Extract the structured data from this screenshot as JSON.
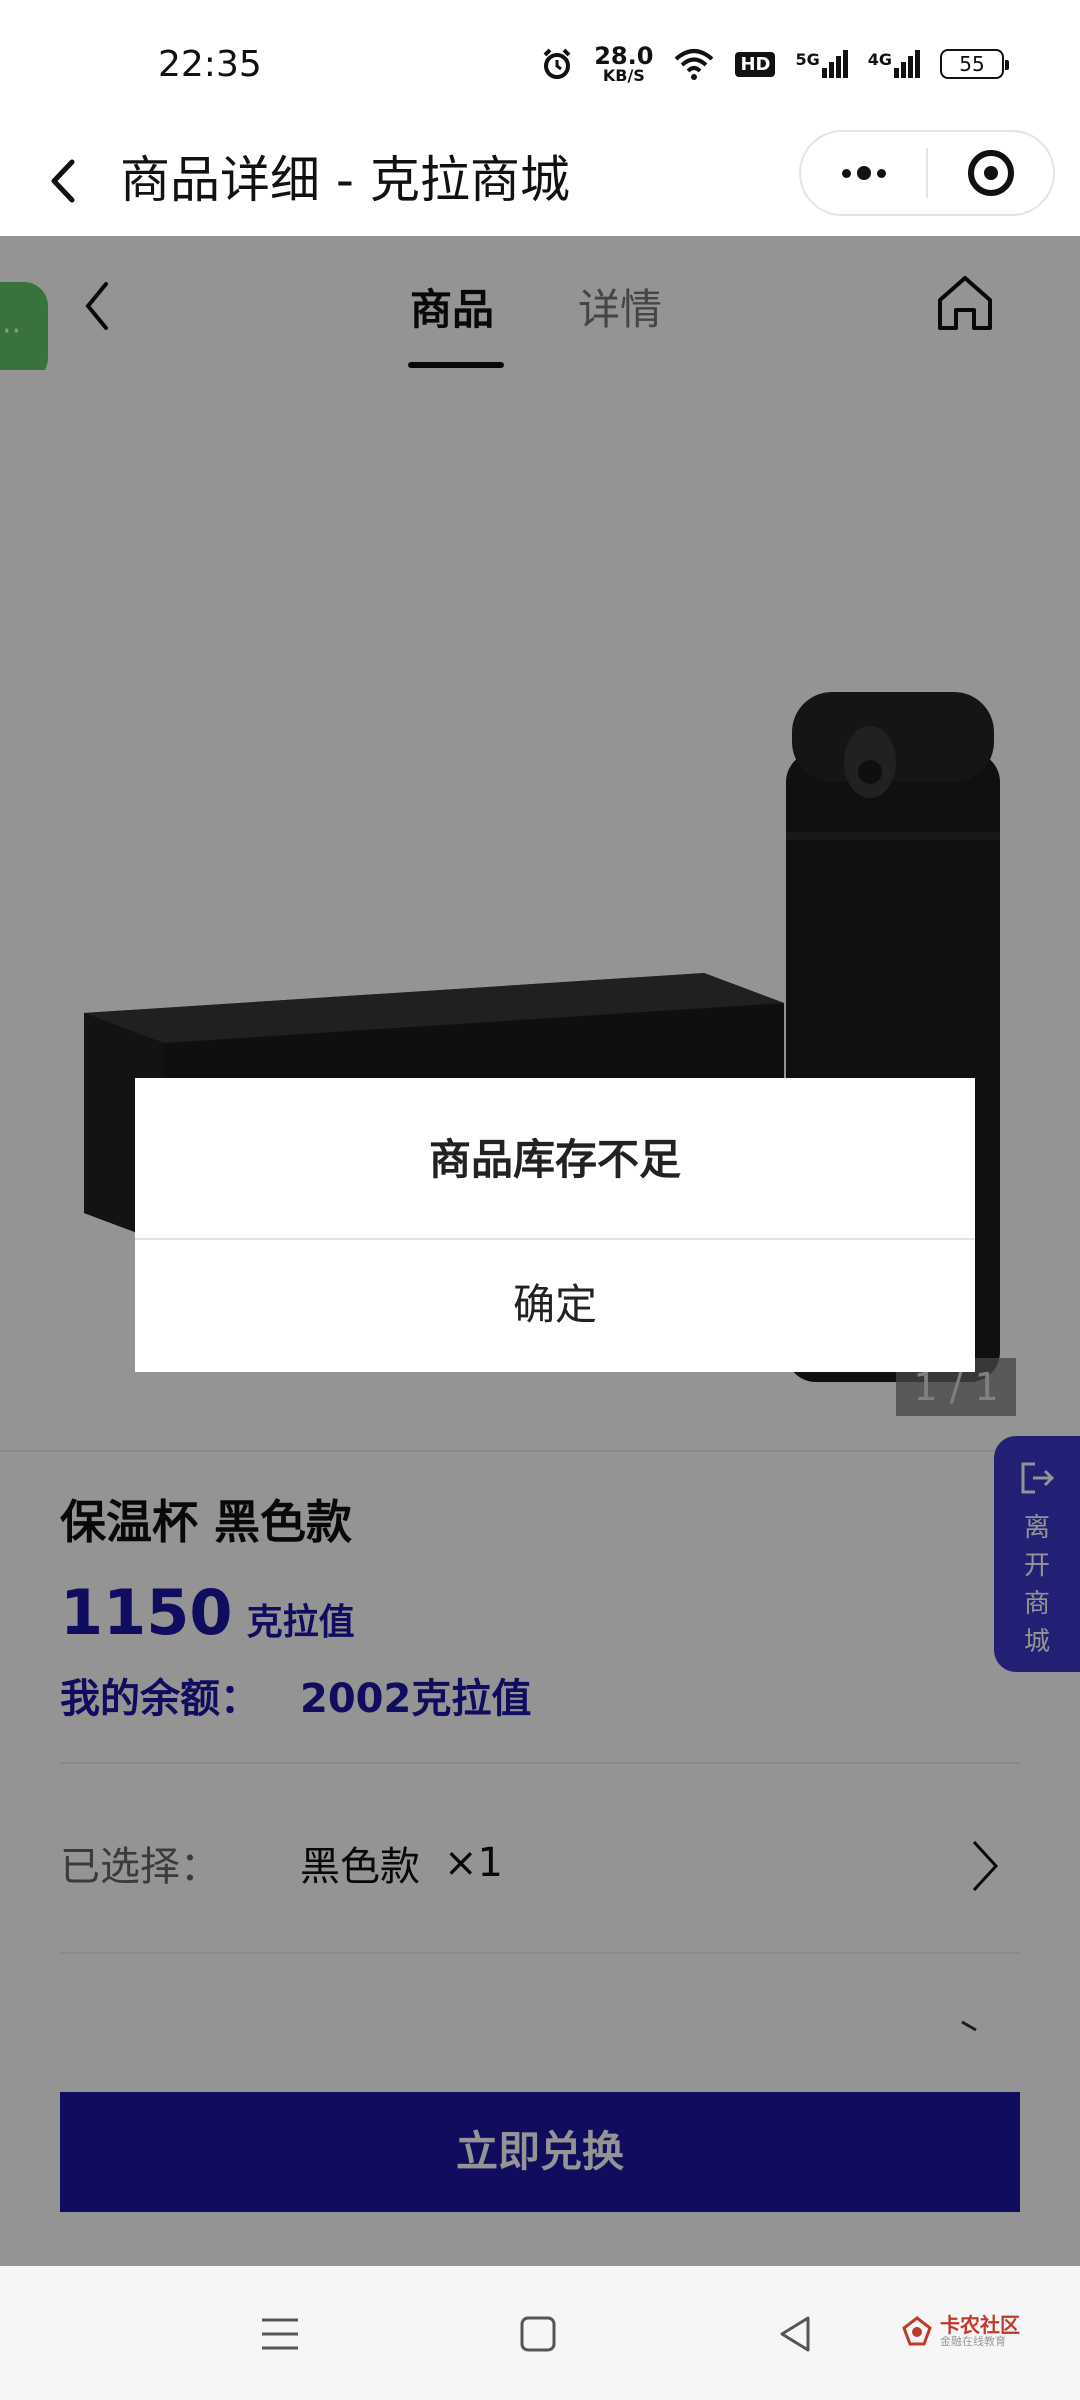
{
  "status_bar": {
    "time": "22:35",
    "speed_value": "28.0",
    "speed_unit": "KB/S",
    "hd_badge": "HD",
    "net1": "5G",
    "net2": "4G",
    "battery": "55"
  },
  "mp_nav": {
    "title": "商品详细 - 克拉商城"
  },
  "tabs": [
    {
      "label": "商品",
      "active": true
    },
    {
      "label": "详情",
      "active": false
    }
  ],
  "product": {
    "image_counter": "1 / 1",
    "name": "保温杯 黑色款",
    "price": "1150",
    "price_unit": "克拉值",
    "balance_label": "我的余额：",
    "balance_value": "2002克拉值",
    "selected_label": "已选择：",
    "selected_value": "黑色款",
    "selected_qty": "×1"
  },
  "side_tab": {
    "chars": [
      "离",
      "开",
      "商",
      "城"
    ]
  },
  "redeem_button": "立即兑换",
  "dialog": {
    "message": "商品库存不足",
    "confirm": "确定"
  },
  "watermark": {
    "main": "卡农社区",
    "sub": "金融在线教育"
  },
  "colors": {
    "accent": "#1e17a3",
    "side_tab": "#3b38c9",
    "float_bubble": "#61c46a"
  }
}
